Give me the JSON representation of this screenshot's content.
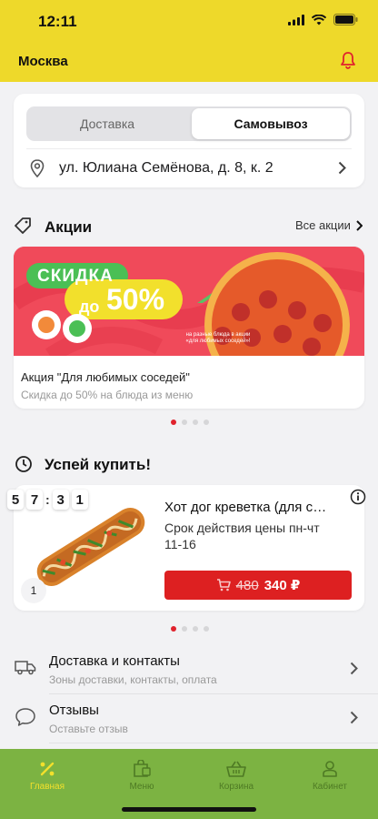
{
  "status": {
    "time": "12:11"
  },
  "header": {
    "city": "Москва"
  },
  "delivery": {
    "options": [
      "Доставка",
      "Самовывоз"
    ],
    "selected": "Самовывоз",
    "address": "ул. Юлиана Семёнова, д. 8, к. 2"
  },
  "promos": {
    "title": "Акции",
    "all_link": "Все акции",
    "banner": {
      "badge_top": "СКИДКА",
      "badge_prefix": "до",
      "badge_value": "50%",
      "note": "на разные блюда в акции «для любимых соседей»!"
    },
    "item_title": "Акция \"Для любимых соседей\"",
    "item_subtitle": "Скидка до 50% на блюда из меню",
    "pager": {
      "count": 4,
      "active": 0
    }
  },
  "deals": {
    "title": "Успей купить!",
    "timer": [
      "5",
      "7",
      "3",
      "1"
    ],
    "item": {
      "name": "Хот дог креветка (для сосе...",
      "period": "Срок действия цены пн-чт 11-16",
      "old_price": "480",
      "new_price": "340 ₽",
      "quantity": "1"
    },
    "pager": {
      "count": 4,
      "active": 0
    }
  },
  "links": [
    {
      "title": "Доставка и контакты",
      "subtitle": "Зоны доставки, контакты, оплата",
      "icon": "truck-icon"
    },
    {
      "title": "Отзывы",
      "subtitle": "Оставьте отзыв",
      "icon": "speech-bubble-icon"
    }
  ],
  "tabs": [
    {
      "label": "Главная",
      "icon": "percent-icon",
      "active": true
    },
    {
      "label": "Меню",
      "icon": "menu-bag-icon",
      "active": false
    },
    {
      "label": "Корзина",
      "icon": "basket-icon",
      "active": false
    },
    {
      "label": "Кабинет",
      "icon": "user-icon",
      "active": false
    }
  ],
  "colors": {
    "brand_yellow": "#eed92a",
    "tab_green": "#7cb342",
    "accent_red": "#dd2021"
  }
}
